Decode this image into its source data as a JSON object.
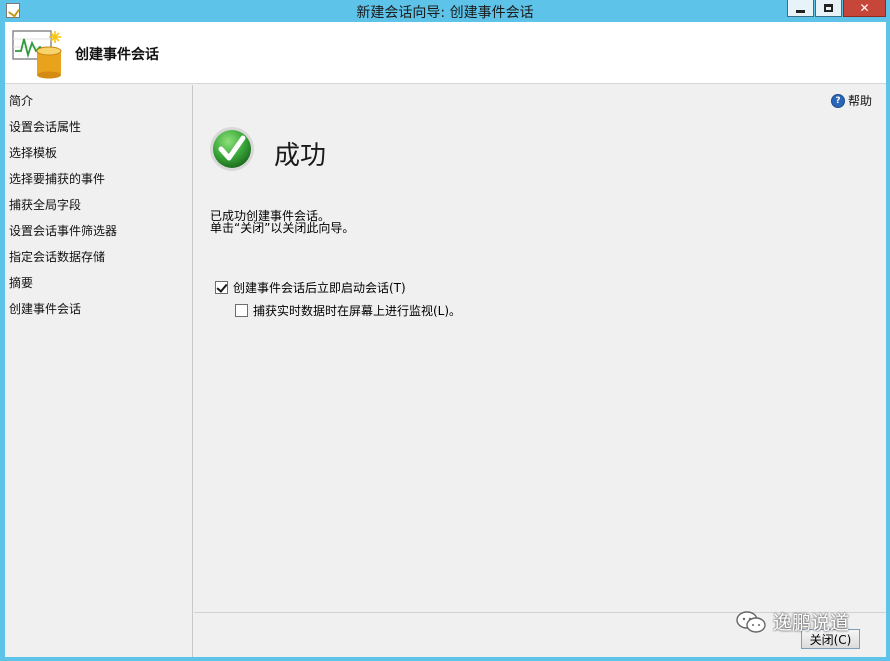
{
  "window": {
    "title": "新建会话向导: 创建事件会话"
  },
  "header": {
    "title": "创建事件会话",
    "logo_icon": "event-session-wizard-icon"
  },
  "nav": {
    "items": [
      {
        "label": "简介"
      },
      {
        "label": "设置会话属性"
      },
      {
        "label": "选择模板"
      },
      {
        "label": "选择要捕获的事件"
      },
      {
        "label": "捕获全局字段"
      },
      {
        "label": "设置会话事件筛选器"
      },
      {
        "label": "指定会话数据存储"
      },
      {
        "label": "摘要"
      },
      {
        "label": "创建事件会话"
      }
    ]
  },
  "main": {
    "help_label": "帮助",
    "help_icon": "help-icon",
    "status_title": "成功",
    "status_icon": "success-check-icon",
    "message_line1": "已成功创建事件会话。",
    "message_line2": "单击“关闭”以关闭此向导。",
    "options": {
      "start_session": {
        "label": "创建事件会话后立即启动会话(T)",
        "checked": true
      },
      "watch_live": {
        "label": "捕获实时数据时在屏幕上进行监视(L)。",
        "checked": false
      }
    }
  },
  "footer": {
    "close_label": "关闭(C)"
  },
  "watermark": {
    "text": "逸鹏说道"
  },
  "colors": {
    "titlebar": "#5ec3e8",
    "close_button": "#c7463a",
    "success_green": "#3aa83a"
  }
}
